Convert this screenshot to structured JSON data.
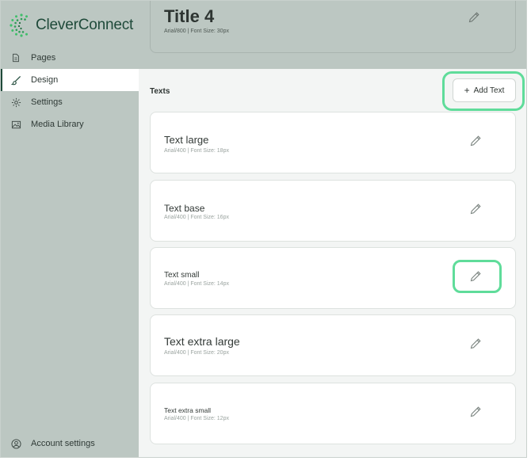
{
  "brand": {
    "name": "CleverConnect",
    "accent": "#5fdc9a",
    "dark": "#1f4a3a"
  },
  "sidebar": {
    "items": [
      {
        "label": "Pages",
        "icon": "page-icon"
      },
      {
        "label": "Design",
        "icon": "brush-icon",
        "active": true
      },
      {
        "label": "Settings",
        "icon": "gear-icon"
      },
      {
        "label": "Media Library",
        "icon": "image-icon"
      }
    ],
    "account": {
      "label": "Account settings",
      "icon": "user-circle-icon"
    }
  },
  "title_style": {
    "name": "Title 4",
    "meta": "Arial/800 | Font Size: 30px"
  },
  "texts_section": {
    "label": "Texts",
    "add_button": {
      "label": "Add Text",
      "icon": "plus-icon"
    },
    "items": [
      {
        "name": "Text large",
        "meta": "Arial/400 | Font Size: 18px"
      },
      {
        "name": "Text base",
        "meta": "Arial/400 | Font Size: 16px"
      },
      {
        "name": "Text small",
        "meta": "Arial/400 | Font Size: 14px"
      },
      {
        "name": "Text extra large",
        "meta": "Arial/400 | Font Size: 20px"
      },
      {
        "name": "Text extra small",
        "meta": "Arial/400 | Font Size: 12px"
      }
    ]
  }
}
